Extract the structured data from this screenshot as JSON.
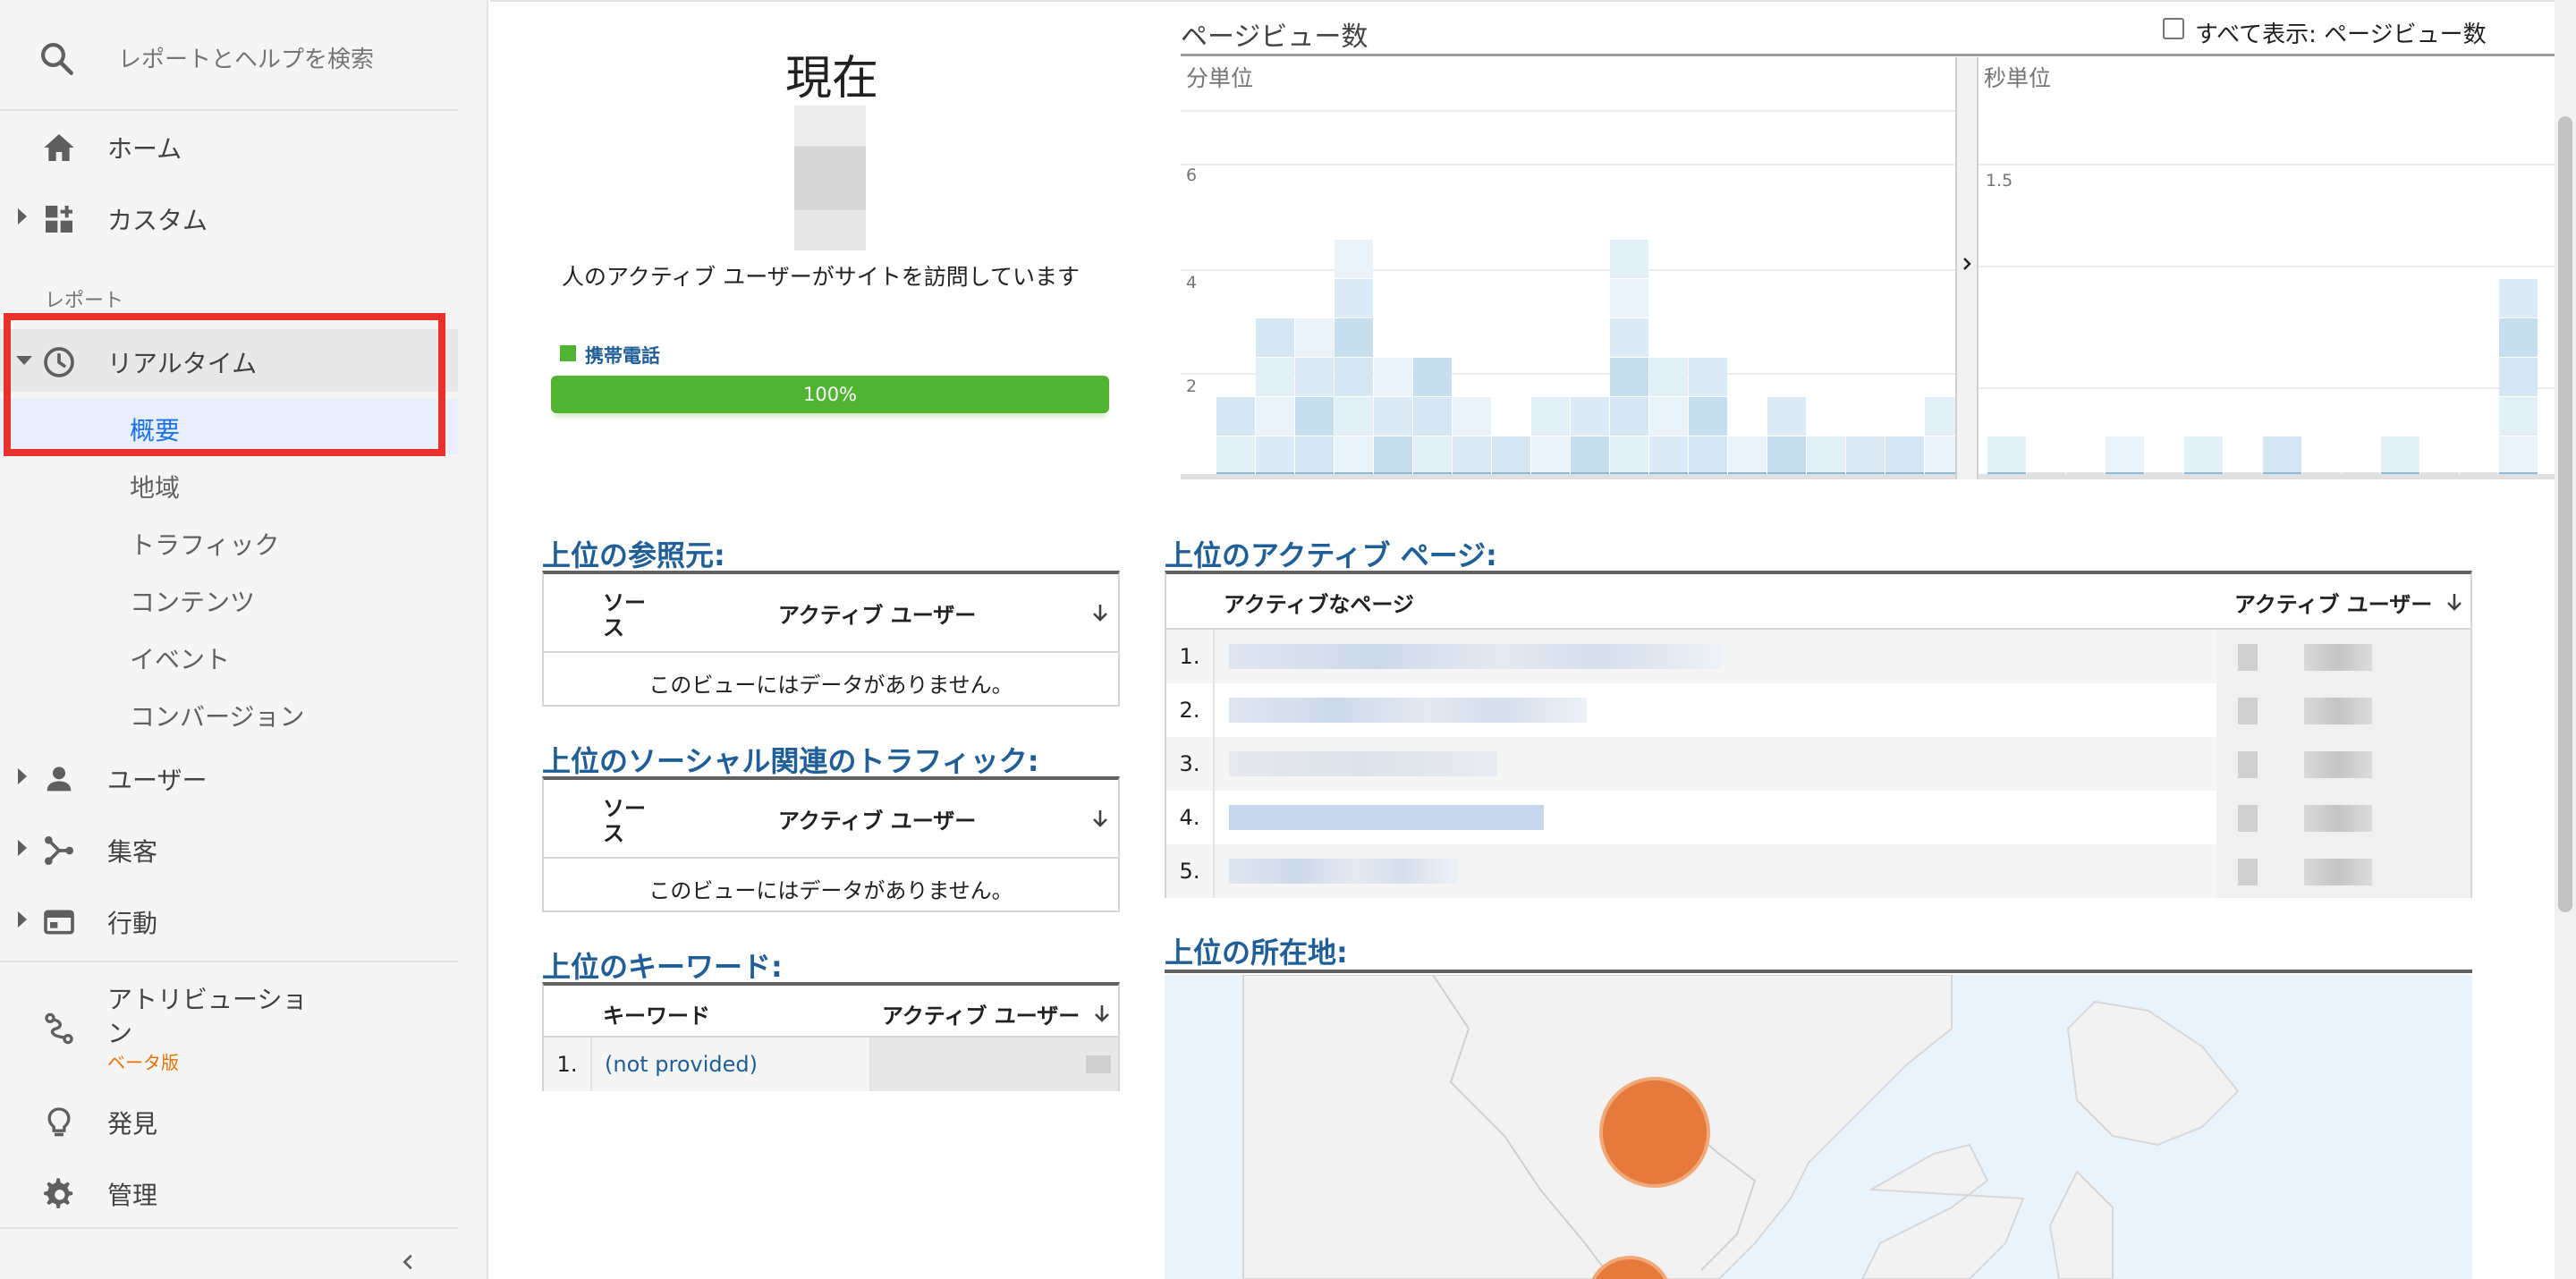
{
  "sidebar": {
    "search_placeholder": "レポートとヘルプを検索",
    "home": "ホーム",
    "custom": "カスタム",
    "reports_section": "レポート",
    "realtime": "リアルタイム",
    "realtime_sub": [
      "概要",
      "地域",
      "トラフィック",
      "コンテンツ",
      "イベント",
      "コンバージョン"
    ],
    "users": "ユーザー",
    "acquisition": "集客",
    "behavior": "行動",
    "attribution": "アトリビューショ",
    "attribution_wrap": "ン",
    "beta": "ベータ版",
    "discover": "発見",
    "admin": "管理"
  },
  "now": {
    "title": "現在",
    "subtitle": "人のアクティブ ユーザーがサイトを訪問しています",
    "device_label": "携帯電話",
    "device_percent": "100%",
    "device_share": 1.0
  },
  "pageviews": {
    "title": "ページビュー数",
    "show_all_label": "すべて表示: ページビュー数",
    "per_minute_label": "分単位",
    "per_second_label": "秒単位",
    "per_minute_ticks": [
      "2",
      "4",
      "6"
    ],
    "per_second_ticks": [
      "1.5"
    ]
  },
  "referrals": {
    "title": "上位の参照元:",
    "col_source": "ソース",
    "col_active": "アクティブ ユーザー",
    "empty": "このビューにはデータがありません。"
  },
  "social": {
    "title": "上位のソーシャル関連のトラフィック:",
    "col_source": "ソース",
    "col_active": "アクティブ ユーザー",
    "empty": "このビューにはデータがありません。"
  },
  "keywords": {
    "title": "上位のキーワード:",
    "col_keyword": "キーワード",
    "col_active": "アクティブ ユーザー",
    "rows": [
      {
        "rank": "1.",
        "keyword": "(not provided)"
      }
    ]
  },
  "active_pages": {
    "title": "上位のアクティブ ページ:",
    "col_page": "アクティブなページ",
    "col_active": "アクティブ ユーザー",
    "ranks": [
      "1.",
      "2.",
      "3.",
      "4.",
      "5."
    ]
  },
  "locations": {
    "title": "上位の所在地:"
  },
  "colors": {
    "accent_blue": "#1f5e96",
    "mobile_green": "#50b432",
    "highlight_red": "#e8312a",
    "map_bubble": "#e67a3c"
  }
}
